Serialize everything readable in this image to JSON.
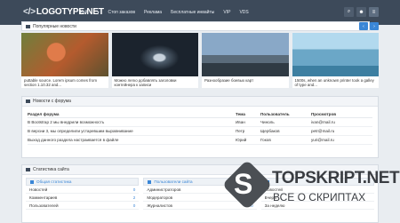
{
  "header": {
    "logo": "LOGOTYPE.NET",
    "nav": [
      "Кай",
      "Стоп заказов",
      "Реклама",
      "Бесплатные инвайты",
      "VIP",
      "VDS"
    ]
  },
  "news": {
    "title": "Популярные новости",
    "slides": [
      "puttable source. Lorem ipsum comes from section 1.10.32 and...",
      "Можно легко добавлять заголовки контейнера к записи",
      "Разнообразие боевых карт",
      "1500s, when an unknown printer took a galley of type and..."
    ]
  },
  "forum": {
    "title": "Новости с форума",
    "headers": [
      "Раздел форума",
      "Тема",
      "Пользователь",
      "Просмотров"
    ],
    "rows": [
      [
        "В Bootstrap 2 мы внедрили возможность",
        "Иван",
        "Чиноль",
        "ivan@mail.ru"
      ],
      [
        "В версии 3, мы определили устаревшим выравнивание",
        "Петр",
        "Щербаков",
        "petr@mail.ru"
      ],
      [
        "Выход данного раздела настраивается в файле",
        "Юрий",
        "Гоков",
        "yuri@mail.ru"
      ]
    ]
  },
  "stats": {
    "title": "Статистика сайта",
    "col1_head": "Общая статистика",
    "col1_rows": [
      [
        "Новостей",
        "0"
      ],
      [
        "Комментариев",
        "2"
      ],
      [
        "Пользователей",
        "0"
      ]
    ],
    "col2_head": "Пользователи сайта",
    "col2_rows": [
      [
        "Администраторов",
        "0"
      ],
      [
        "Модераторов",
        "0"
      ],
      [
        "Журналистов",
        "0"
      ]
    ],
    "col3_rows": [
      [
        "Новостей",
        ""
      ],
      [
        "Вчера",
        ""
      ],
      [
        "За неделю",
        ""
      ]
    ]
  },
  "watermark": {
    "line1": "TOPSKRIPT.NET",
    "line2": "ВСЕ О СКРИПТАХ"
  }
}
